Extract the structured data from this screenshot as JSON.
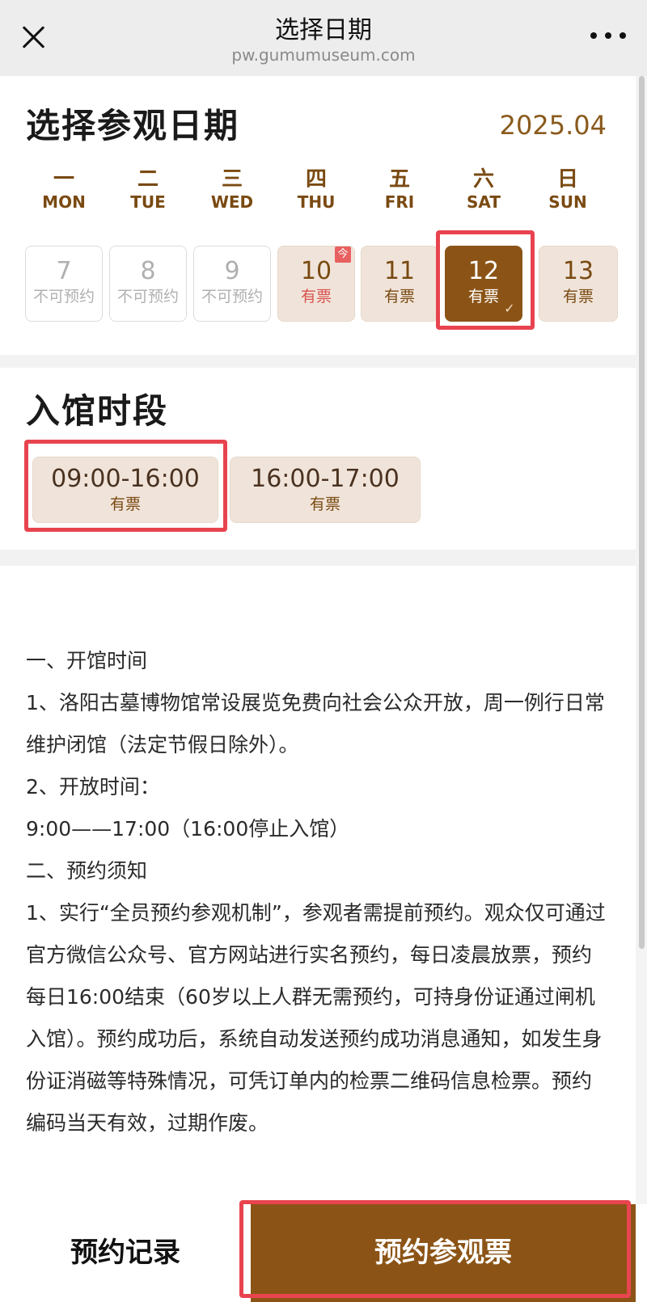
{
  "nav": {
    "title": "选择日期",
    "domain": "pw.gumumuseum.com",
    "close_icon": "close-icon",
    "more_icon": "more-icon"
  },
  "date_section": {
    "title": "选择参观日期",
    "month": "2025.04",
    "weekdays": [
      {
        "cn": "一",
        "en": "MON"
      },
      {
        "cn": "二",
        "en": "TUE"
      },
      {
        "cn": "三",
        "en": "WED"
      },
      {
        "cn": "四",
        "en": "THU"
      },
      {
        "cn": "五",
        "en": "FRI"
      },
      {
        "cn": "六",
        "en": "SAT"
      },
      {
        "cn": "日",
        "en": "SUN"
      }
    ],
    "days": [
      {
        "num": "7",
        "status": "不可预约",
        "state": "unavailable"
      },
      {
        "num": "8",
        "status": "不可预约",
        "state": "unavailable"
      },
      {
        "num": "9",
        "status": "不可预约",
        "state": "unavailable"
      },
      {
        "num": "10",
        "status": "有票",
        "state": "available",
        "badge": "今"
      },
      {
        "num": "11",
        "status": "有票",
        "state": "available"
      },
      {
        "num": "12",
        "status": "有票",
        "state": "selected",
        "check": "✓"
      },
      {
        "num": "13",
        "status": "有票",
        "state": "available"
      }
    ]
  },
  "time_section": {
    "title": "入馆时段",
    "slots": [
      {
        "range": "09:00-16:00",
        "status": "有票"
      },
      {
        "range": "16:00-17:00",
        "status": "有票"
      }
    ]
  },
  "notice": {
    "lines": [
      "一、开馆时间",
      "1、洛阳古墓博物馆常设展览免费向社会公众开放，周一例行日常维护闭馆（法定节假日除外）。",
      "2、开放时间：",
      "9:00——17:00（16:00停止入馆）",
      "二、预约须知",
      "1、实行“全员预约参观机制”，参观者需提前预约。观众仅可通过官方微信公众号、官方网站进行实名预约，每日凌晨放票，预约每日16:00结束（60岁以上人群无需预约，可持身份证通过闸机入馆）。预约成功后，系统自动发送预约成功消息通知，如发生身份证消磁等特殊情况，可凭订单内的检票二维码信息检票。预约编码当天有效，过期作废。"
    ]
  },
  "bottom": {
    "records_label": "预约记录",
    "book_label": "预约参观票"
  },
  "colors": {
    "brand_brown": "#8b5416",
    "card_tan": "#f0e4da",
    "highlight_red": "#e8444f"
  }
}
